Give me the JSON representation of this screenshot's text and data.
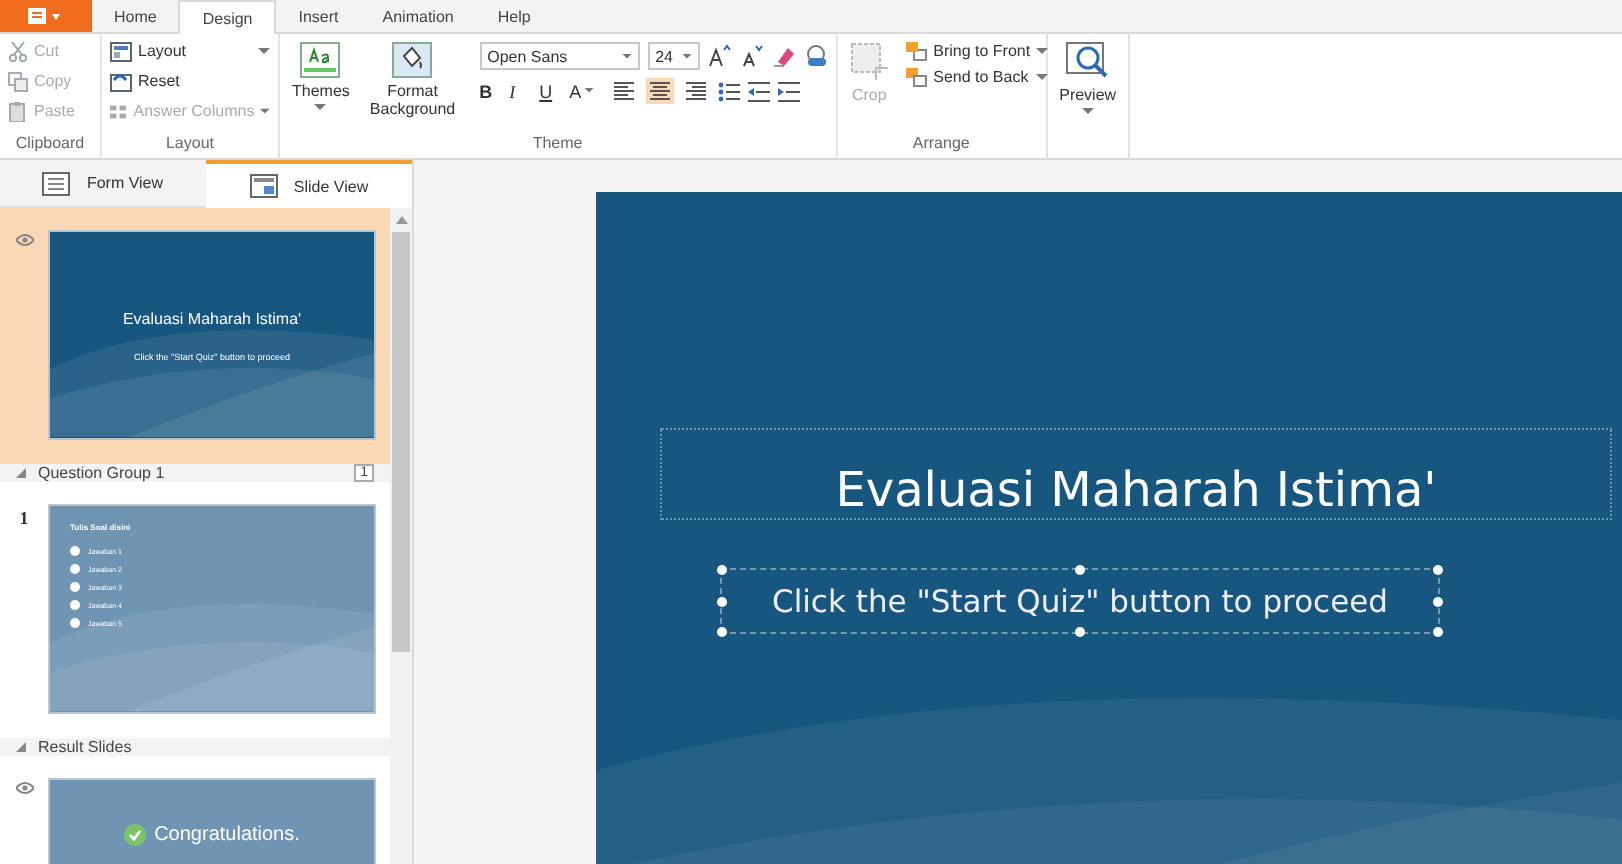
{
  "app_menu": {
    "kind": "menu"
  },
  "tabs": [
    {
      "label": "Home",
      "selected": false
    },
    {
      "label": "Design",
      "selected": true
    },
    {
      "label": "Insert",
      "selected": false
    },
    {
      "label": "Animation",
      "selected": false
    },
    {
      "label": "Help",
      "selected": false
    }
  ],
  "ribbon": {
    "clipboard": {
      "label": "Clipboard",
      "items": [
        {
          "label": "Cut",
          "kind": "cut",
          "disabled": true
        },
        {
          "label": "Copy",
          "kind": "copy",
          "disabled": true
        },
        {
          "label": "Paste",
          "kind": "paste",
          "disabled": true
        }
      ]
    },
    "layout": {
      "label": "Layout",
      "items": [
        {
          "label": "Layout",
          "kind": "layout",
          "disabled": false,
          "dropdown": true
        },
        {
          "label": "Reset",
          "kind": "reset",
          "disabled": false,
          "dropdown": false
        },
        {
          "label": "Answer Columns",
          "kind": "columns",
          "disabled": true,
          "dropdown": true
        }
      ]
    },
    "theme": {
      "label": "Theme",
      "themes_button": "Themes",
      "format_background": [
        "Format",
        "Background"
      ],
      "font": "Open Sans",
      "size": "24",
      "format_buttons": [
        {
          "label": "B",
          "kind": "bold"
        },
        {
          "label": "I",
          "kind": "italic"
        },
        {
          "label": "U",
          "kind": "underline"
        },
        {
          "label": "A",
          "kind": "color"
        }
      ],
      "align": [
        {
          "kind": "left",
          "selected": false
        },
        {
          "kind": "center",
          "selected": true
        },
        {
          "kind": "right",
          "selected": false
        }
      ]
    },
    "arrange": {
      "label": "Arrange",
      "crop": {
        "label": "Crop",
        "disabled": true
      },
      "items": [
        {
          "label": "Bring to Front",
          "kind": "front"
        },
        {
          "label": "Send to Back",
          "kind": "back"
        }
      ]
    },
    "preview": {
      "label": "Preview"
    }
  },
  "view_tabs": [
    {
      "label": "Form View",
      "kind": "form",
      "selected": false
    },
    {
      "label": "Slide View",
      "kind": "slide",
      "selected": true
    }
  ],
  "slides": [
    {
      "kind": "intro",
      "selected": true,
      "title": "Evaluasi Maharah Istima'",
      "subtitle": "Click the \"Start Quiz\" button to proceed"
    },
    {
      "kind": "group",
      "label": "Question Group 1",
      "count": "1"
    },
    {
      "kind": "question",
      "selected": false,
      "number": "1",
      "title": "Tulis Soal disini",
      "answers": [
        "Jawaban 1",
        "Jawaban 2",
        "Jawaban 3",
        "Jawaban 4",
        "Jawaban 5"
      ]
    },
    {
      "kind": "group",
      "label": "Result Slides"
    },
    {
      "kind": "result",
      "selected": false,
      "title": "Congratulations."
    }
  ],
  "canvas": {
    "title": "Evaluasi Maharah Istima'",
    "subtitle": "Click the \"Start Quiz\" button to proceed"
  }
}
